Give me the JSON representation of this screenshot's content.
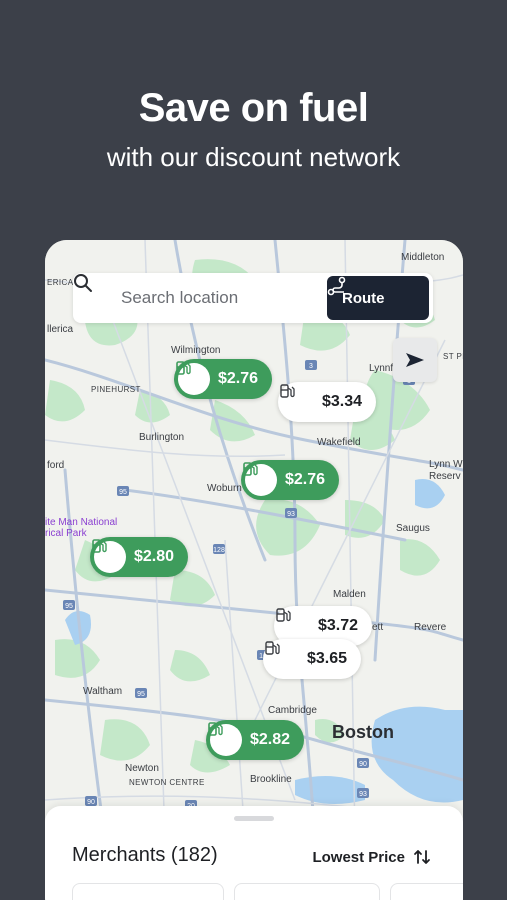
{
  "promo": {
    "headline": "Save on fuel",
    "subhead": "with our discount network"
  },
  "search": {
    "placeholder": "Search location",
    "route_label": "Route"
  },
  "map": {
    "places": {
      "middleton": "Middleton",
      "erica": "ERICA",
      "llerica": "llerica",
      "wilmington": "Wilmington",
      "pinehurst": "PINEHURST",
      "lynnfield": "Lynnfield",
      "st_peabody": "ST PEA",
      "burlington": "Burlington",
      "wakefield": "Wakefield",
      "ford": "ford",
      "lynn_woods": "Lynn W",
      "reserv": "Reserv",
      "woburn": "Woburn",
      "saugus": "Saugus",
      "park_line1": "ite Man National",
      "park_line2": "rical Park",
      "malden": "Malden",
      "ett": "ett",
      "revere": "Revere",
      "waltham": "Waltham",
      "cambridge": "Cambridge",
      "boston": "Boston",
      "newton": "Newton",
      "newton_centre": "NEWTON CENTRE",
      "brookline": "Brookline"
    },
    "highways": [
      "93",
      "95",
      "95",
      "128",
      "95",
      "3",
      "1",
      "16",
      "90",
      "90",
      "20",
      "93"
    ],
    "stations": [
      {
        "price": "$2.76",
        "style": "green"
      },
      {
        "price": "$3.34",
        "style": "white"
      },
      {
        "price": "$2.76",
        "style": "green"
      },
      {
        "price": "$2.80",
        "style": "green"
      },
      {
        "price": "$3.72",
        "style": "white"
      },
      {
        "price": "$3.65",
        "style": "white"
      },
      {
        "price": "$2.82",
        "style": "green"
      }
    ]
  },
  "sheet": {
    "title": "Merchants (182)",
    "sort_label": "Lowest Price"
  },
  "colors": {
    "background": "#3c4049",
    "accent_green": "#3e9c5c",
    "route_button": "#1c2433",
    "map_land": "#f1f2ee",
    "map_park": "#c4e8c9",
    "map_water": "#a9d0f1",
    "map_road": "#b9c8dc"
  },
  "icons": {
    "search": "search-icon",
    "route": "route-icon",
    "locate": "navigation-arrow-icon",
    "fuel": "fuel-pump-icon",
    "sort": "sort-arrows-icon"
  }
}
